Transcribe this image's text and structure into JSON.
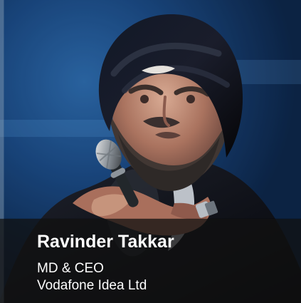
{
  "profile": {
    "name": "Ravinder Takkar",
    "title": "MD & CEO",
    "company": "Vodafone Idea Ltd"
  },
  "colors": {
    "background_blue": "#173f76",
    "caption_overlay": "#121212",
    "text": "#ffffff"
  }
}
